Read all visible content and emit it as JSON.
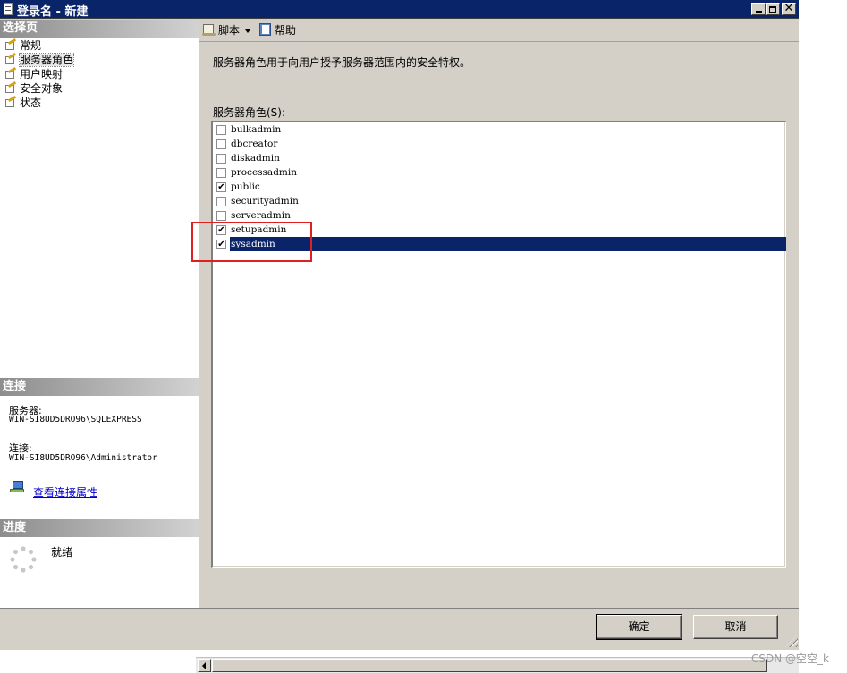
{
  "window": {
    "title": "登录名 - 新建"
  },
  "left_pane": {
    "select_page_header": "选择页",
    "nav_items": [
      {
        "label": "常规",
        "icon": "page-pen-icon"
      },
      {
        "label": "服务器角色",
        "icon": "page-pen-icon",
        "selected": true
      },
      {
        "label": "用户映射",
        "icon": "page-pen-icon"
      },
      {
        "label": "安全对象",
        "icon": "page-pen-icon"
      },
      {
        "label": "状态",
        "icon": "page-pen-icon"
      }
    ],
    "connection": {
      "header": "连接",
      "server_label": "服务器:",
      "server_value": "WIN-SI8UD5DRO96\\SQLEXPRESS",
      "connection_label": "连接:",
      "connection_value": "WIN-SI8UD5DRO96\\Administrator",
      "view_properties_link": "查看连接属性"
    },
    "progress": {
      "header": "进度",
      "status": "就绪"
    }
  },
  "toolbar": {
    "script_label": "脚本",
    "help_label": "帮助"
  },
  "main": {
    "description": "服务器角色用于向用户授予服务器范围内的安全特权。",
    "list_label": "服务器角色(S):",
    "roles": [
      {
        "name": "bulkadmin",
        "checked": false
      },
      {
        "name": "dbcreator",
        "checked": false
      },
      {
        "name": "diskadmin",
        "checked": false
      },
      {
        "name": "processadmin",
        "checked": false
      },
      {
        "name": "public",
        "checked": true
      },
      {
        "name": "securityadmin",
        "checked": false
      },
      {
        "name": "serveradmin",
        "checked": false
      },
      {
        "name": "setupadmin",
        "checked": true
      },
      {
        "name": "sysadmin",
        "checked": true,
        "selected": true
      }
    ]
  },
  "buttons": {
    "ok": "确定",
    "cancel": "取消"
  },
  "watermark": "CSDN @空空_k",
  "colors": {
    "title_bar": "#0a246a",
    "selection": "#0a246a",
    "highlight_box": "#e02020",
    "link": "#0000cc"
  }
}
